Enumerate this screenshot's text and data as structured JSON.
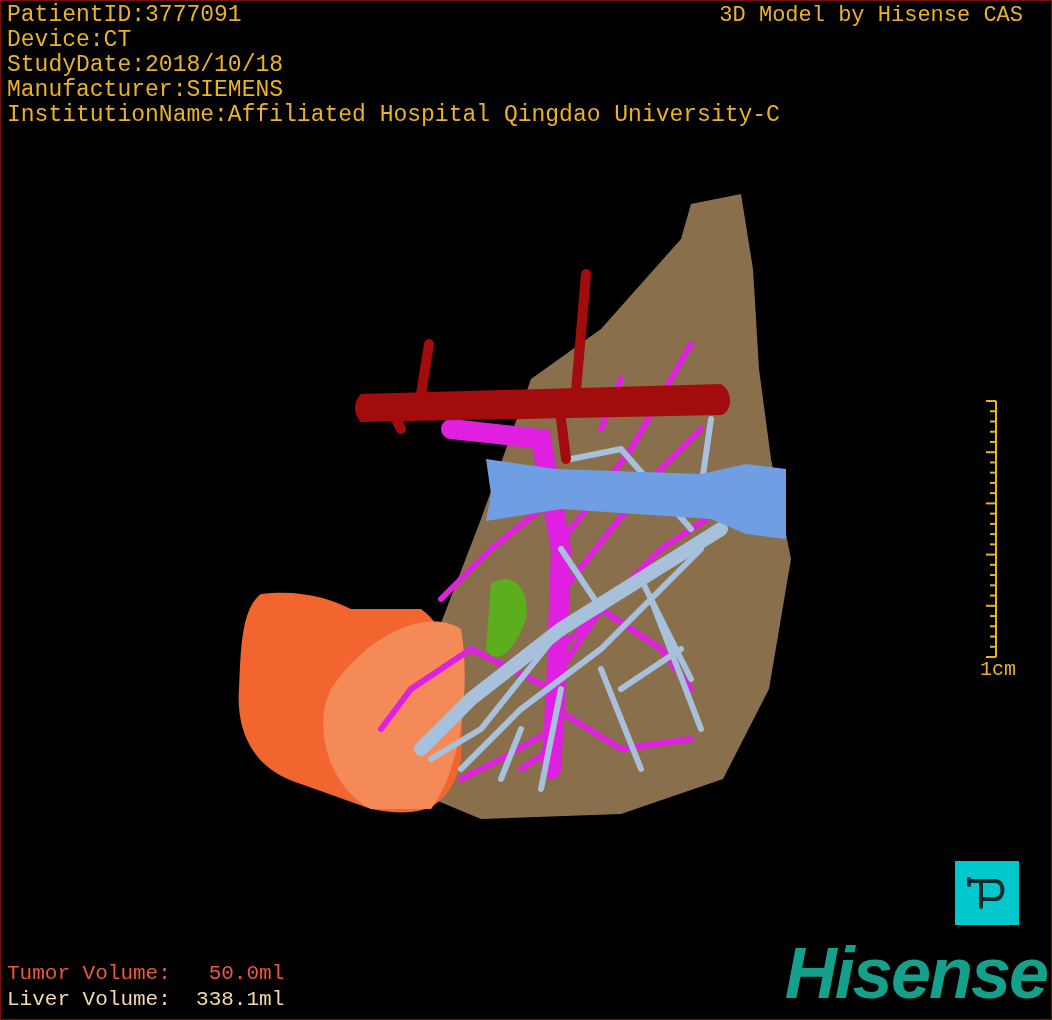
{
  "info_lines": [
    {
      "label": "PatientID:",
      "value": "3777091"
    },
    {
      "label": "Device:",
      "value": "CT"
    },
    {
      "label": "StudyDate:",
      "value": "2018/10/18"
    },
    {
      "label": "Manufacturer:",
      "value": "SIEMENS"
    },
    {
      "label": "InstitutionName:",
      "value": "Affiliated Hospital Qingdao University-C"
    }
  ],
  "title": "3D Model by Hisense CAS",
  "scale": {
    "label": "1cm"
  },
  "volumes": [
    {
      "kind": "tumor",
      "label": "Tumor Volume:",
      "value": "50.0ml"
    },
    {
      "kind": "liver",
      "label": "Liver Volume:",
      "value": "338.1ml"
    }
  ],
  "logo": "Hisense"
}
